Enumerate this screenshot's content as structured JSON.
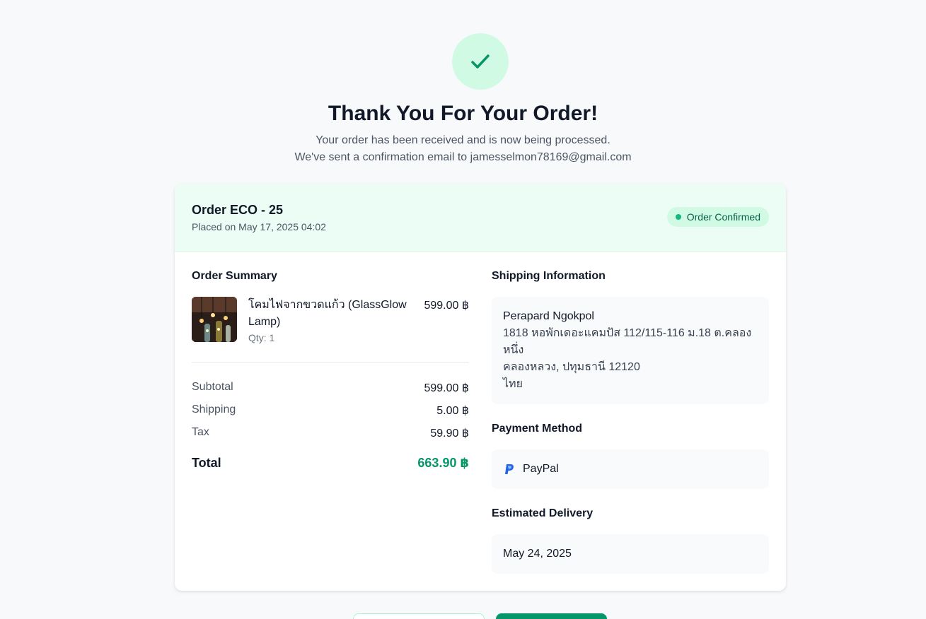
{
  "hero": {
    "title": "Thank You For Your Order!",
    "line1": "Your order has been received and is now being processed.",
    "line2": "We've sent a confirmation email to jamesselmon78169@gmail.com",
    "icon": "check-icon"
  },
  "order": {
    "id": "Order ECO - 25",
    "placed_on": "Placed on May 17, 2025 04:02",
    "status": "Order Confirmed"
  },
  "summary": {
    "title": "Order Summary",
    "item": {
      "name": "โคมไฟจากขวดแก้ว (GlassGlow Lamp)",
      "qty": "Qty: 1",
      "price": "599.00 ฿"
    },
    "subtotal_label": "Subtotal",
    "subtotal_value": "599.00 ฿",
    "shipping_label": "Shipping",
    "shipping_value": "5.00 ฿",
    "tax_label": "Tax",
    "tax_value": "59.90 ฿",
    "total_label": "Total",
    "total_value": "663.90 ฿"
  },
  "shipping": {
    "title": "Shipping Information",
    "name": "Perapard Ngokpol",
    "address1": "1818 หอพักเดอะแคมปัส 112/115-116 ม.18 ต.คลองหนึ่ง",
    "address2": "คลองหลวง, ปทุมธานี 12120",
    "country": "ไทย"
  },
  "payment": {
    "title": "Payment Method",
    "method": "PayPal",
    "icon": "paypal-icon"
  },
  "delivery": {
    "title": "Estimated Delivery",
    "date": "May 24, 2025"
  },
  "colors": {
    "accent": "#059669",
    "badge_bg": "#d1fae5",
    "header_bg": "#ecfdf5"
  }
}
